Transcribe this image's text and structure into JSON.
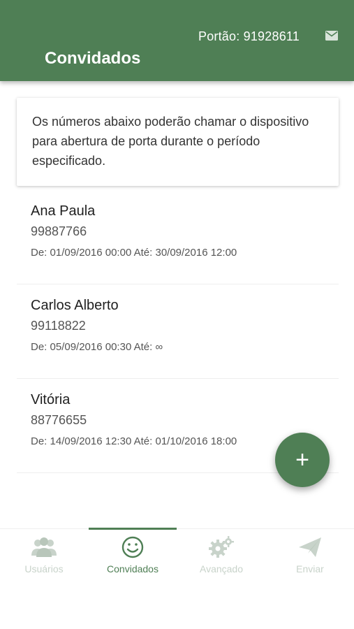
{
  "header": {
    "title": "Convidados",
    "gate_label": "Portão: 91928611",
    "icon": "mail-icon",
    "background_color": "#4f7f55"
  },
  "info": {
    "text": "Os números abaixo poderão chamar o dispositivo para abertura de porta durante o período especificado."
  },
  "guests": [
    {
      "name": "Ana Paula",
      "phone": "99887766",
      "period": "De: 01/09/2016 00:00 Até: 30/09/2016 12:00"
    },
    {
      "name": "Carlos Alberto",
      "phone": "99118822",
      "period": "De: 05/09/2016 00:30 Até: ∞"
    },
    {
      "name": "Vitória",
      "phone": "88776655",
      "period": "De: 14/09/2016 12:30 Até: 01/10/2016 18:00"
    }
  ],
  "fab": {
    "label": "+",
    "icon": "add-icon"
  },
  "bottom_nav": {
    "items": [
      {
        "label": "Usuários",
        "icon": "users-icon",
        "active": false
      },
      {
        "label": "Convidados",
        "icon": "smiley-icon",
        "active": true
      },
      {
        "label": "Avançado",
        "icon": "gears-icon",
        "active": false
      },
      {
        "label": "Enviar",
        "icon": "send-icon",
        "active": false
      }
    ]
  },
  "colors": {
    "accent": "#4f7f55",
    "inactive_nav": "#c8d3ca"
  }
}
